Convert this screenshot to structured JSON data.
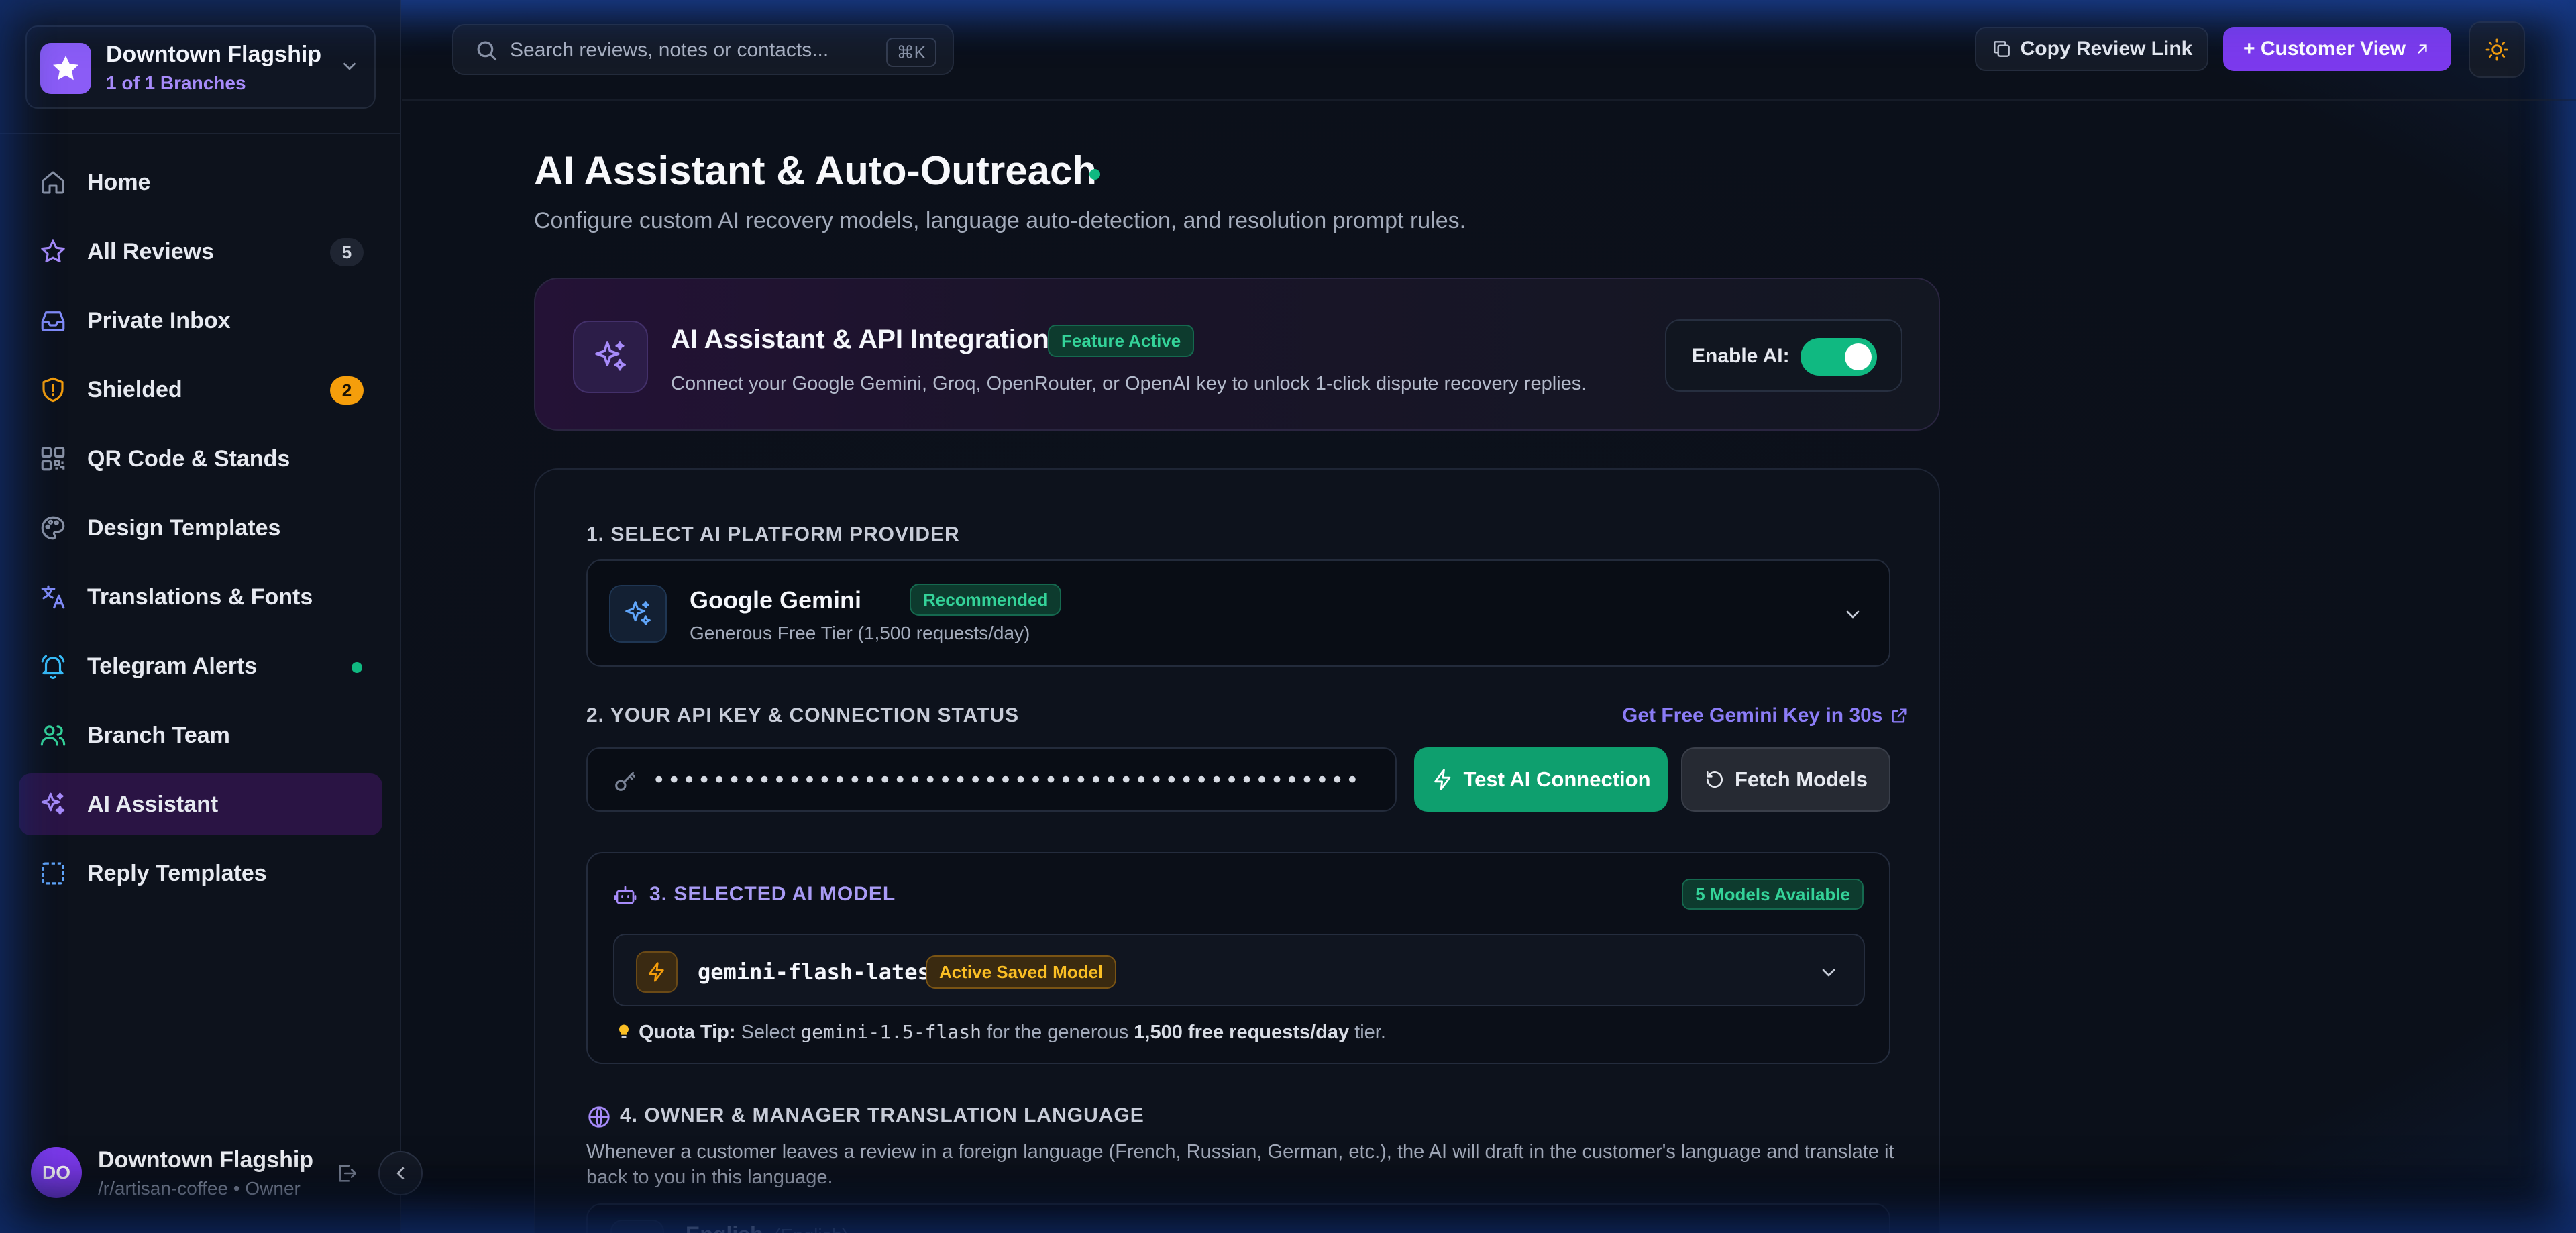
{
  "branch": {
    "name": "Downtown Flagship",
    "subtitle": "1 of 1 Branches"
  },
  "nav": [
    {
      "label": "Home",
      "icon": "home-icon"
    },
    {
      "label": "All Reviews",
      "icon": "star-icon",
      "badge": "5"
    },
    {
      "label": "Private Inbox",
      "icon": "inbox-icon"
    },
    {
      "label": "Shielded",
      "icon": "shield-icon",
      "badge": "2"
    },
    {
      "label": "QR Code & Stands",
      "icon": "qr-code-icon"
    },
    {
      "label": "Design Templates",
      "icon": "palette-icon"
    },
    {
      "label": "Translations & Fonts",
      "icon": "translate-icon"
    },
    {
      "label": "Telegram Alerts",
      "icon": "bell-icon",
      "dot": true
    },
    {
      "label": "Branch Team",
      "icon": "users-icon"
    },
    {
      "label": "AI Assistant",
      "icon": "sparkles-icon",
      "active": true
    },
    {
      "label": "Reply Templates",
      "icon": "template-icon"
    }
  ],
  "user": {
    "initials": "DO",
    "name": "Downtown Flagship",
    "subtitle": "/r/artisan-coffee • Owner"
  },
  "header": {
    "search_placeholder": "Search reviews, notes or contacts...",
    "search_shortcut": "⌘K",
    "copy_link_label": "Copy Review Link",
    "customer_view_label": "+ Customer View"
  },
  "page": {
    "title": "AI Assistant & Auto-Outreach",
    "subtitle": "Configure custom AI recovery models, language auto-detection, and resolution prompt rules."
  },
  "ai_card": {
    "title": "AI Assistant & API Integration",
    "badge": "Feature Active",
    "description": "Connect your Google Gemini, Groq, OpenRouter, or OpenAI key to unlock 1-click dispute recovery replies.",
    "enable_label": "Enable AI:",
    "enabled": true
  },
  "provider": {
    "section_label": "1. SELECT AI PLATFORM PROVIDER",
    "name": "Google Gemini",
    "badge": "Recommended",
    "description": "Generous Free Tier (1,500 requests/day)"
  },
  "api_key": {
    "section_label": "2. YOUR API KEY & CONNECTION STATUS",
    "get_key_link": "Get Free Gemini Key in 30s",
    "masked_value": "••••••••••••••••••••••••••••••••••••••••••••••••••",
    "test_button": "Test AI Connection",
    "fetch_button": "Fetch Models"
  },
  "model": {
    "section_label": "3. SELECTED AI MODEL",
    "available_badge": "5 Models Available",
    "name": "gemini-flash-latest",
    "active_badge": "Active Saved Model",
    "tip_label": "Quota Tip:",
    "tip_pre": "Select",
    "tip_code": "gemini-1.5-flash",
    "tip_mid": "for the generous",
    "tip_bold": "1,500 free requests/day",
    "tip_post": "tier."
  },
  "translation": {
    "section_label": "4. OWNER & MANAGER TRANSLATION LANGUAGE",
    "description": "Whenever a customer leaves a review in a foreign language (French, Russian, German, etc.), the AI will draft in the customer's language and translate it back to you in this language.",
    "language": "English",
    "language_native": "(English)"
  },
  "colors": {
    "accent": "#7c3aed",
    "success": "#10b981",
    "warning": "#f59e0b"
  }
}
